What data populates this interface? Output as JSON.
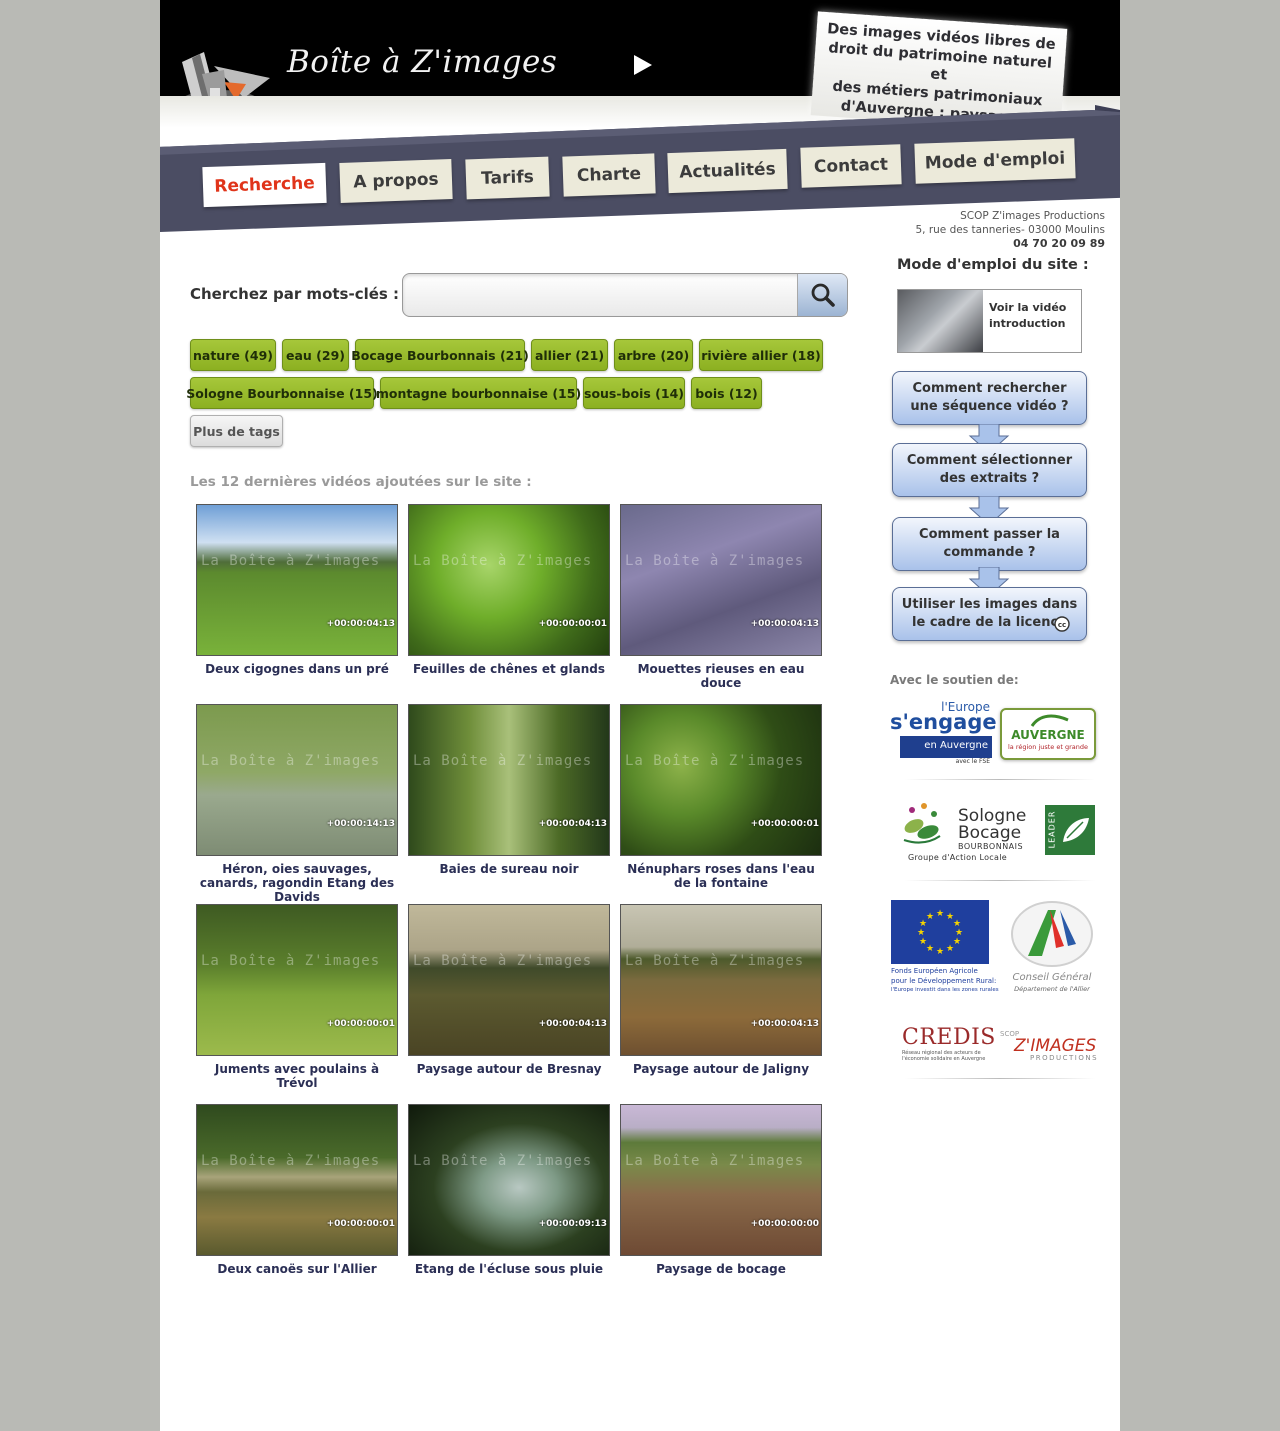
{
  "header": {
    "site_title": "Boîte à Z'images",
    "tagline": [
      "Des images vidéos libres de",
      "droit du patrimoine naturel et",
      "des métiers patrimoniaux",
      "d'Auvergne : paysages, flore.."
    ]
  },
  "nav": {
    "items": [
      {
        "label": "Recherche",
        "active": true
      },
      {
        "label": "A propos",
        "active": false
      },
      {
        "label": "Tarifs",
        "active": false
      },
      {
        "label": "Charte",
        "active": false
      },
      {
        "label": "Actualités",
        "active": false
      },
      {
        "label": "Contact",
        "active": false
      },
      {
        "label": "Mode d'emploi",
        "active": false
      }
    ]
  },
  "address": {
    "company": "SCOP Z'images Productions",
    "street": "5, rue des tanneries- 03000 Moulins",
    "phone": "04 70 20 09 89"
  },
  "search": {
    "label": "Cherchez par mots-clés :",
    "value": "",
    "placeholder": "",
    "button_icon": "search-icon"
  },
  "tags": [
    {
      "label": "nature (49)"
    },
    {
      "label": "eau (29)"
    },
    {
      "label": "Bocage Bourbonnais (21)"
    },
    {
      "label": "allier (21)"
    },
    {
      "label": "arbre (20)"
    },
    {
      "label": "rivière allier (18)"
    },
    {
      "label": "Sologne Bourbonnaise (15)"
    },
    {
      "label": "montagne bourbonnaise (15)"
    },
    {
      "label": "sous-bois (14)"
    },
    {
      "label": "bois (12)"
    }
  ],
  "more_tags_label": "Plus de tags",
  "latest": {
    "heading": "Les 12 dernières vidéos ajoutées sur le site :",
    "videos": [
      {
        "title": "Deux cigognes dans un pré",
        "duration": "+00:00:04:13",
        "watermark": "La Boîte à Z'images"
      },
      {
        "title": "Feuilles de chênes et glands",
        "duration": "+00:00:00:01",
        "watermark": "La Boîte à Z'images"
      },
      {
        "title": "Mouettes rieuses en eau douce",
        "duration": "+00:00:04:13",
        "watermark": "La Boîte à Z'images"
      },
      {
        "title": "Héron, oies sauvages, canards, ragondin Etang des Davids",
        "duration": "+00:00:14:13",
        "watermark": "La Boîte à Z'images"
      },
      {
        "title": "Baies de sureau noir",
        "duration": "+00:00:04:13",
        "watermark": "La Boîte à Z'images"
      },
      {
        "title": "Nénuphars roses dans l'eau de la fontaine",
        "duration": "+00:00:00:01",
        "watermark": "La Boîte à Z'images"
      },
      {
        "title": "Juments avec poulains à Trévol",
        "duration": "+00:00:00:01",
        "watermark": "La Boîte à Z'images"
      },
      {
        "title": "Paysage autour de Bresnay",
        "duration": "+00:00:04:13",
        "watermark": "La Boîte à Z'images"
      },
      {
        "title": "Paysage autour de Jaligny",
        "duration": "+00:00:04:13",
        "watermark": "La Boîte à Z'images"
      },
      {
        "title": "Deux canoës sur l'Allier",
        "duration": "+00:00:00:01",
        "watermark": "La Boîte à Z'images"
      },
      {
        "title": "Etang de l'écluse sous pluie",
        "duration": "+00:00:09:13",
        "watermark": "La Boîte à Z'images"
      },
      {
        "title": "Paysage de bocage",
        "duration": "+00:00:00:00",
        "watermark": "La Boîte à Z'images"
      }
    ]
  },
  "sidebar": {
    "title": "Mode d'emploi du site :",
    "intro_video": "Voir la vidéo introduction",
    "steps": [
      {
        "label": "Comment rechercher une séquence vidéo ?"
      },
      {
        "label": "Comment sélectionner des extraits ?"
      },
      {
        "label": "Comment passer la commande ?"
      },
      {
        "label": "Utiliser les images dans le cadre de la licence"
      }
    ],
    "support_label": "Avec le soutien de:",
    "logos": {
      "europe": {
        "line1": "l'Europe",
        "line2": "s'engage",
        "line3": "en Auvergne",
        "line4": "avec le FSE"
      },
      "auvergne": {
        "line1": "AUVERGNE",
        "line2": "la région juste et grande"
      },
      "sologne": {
        "line1": "Sologne",
        "line2": "Bocage",
        "line3": "BOURBONNAIS",
        "line4": "Groupe d'Action Locale"
      },
      "leader": "LEADER",
      "feader": {
        "line1": "Fonds Européen Agricole",
        "line2": "pour le Développement Rural:",
        "line3": "l'Europe investit dans les zones rurales"
      },
      "conseil": {
        "line1": "Conseil Général",
        "line2": "Département de l'Allier"
      },
      "credis": {
        "line1": "CREDIS",
        "line2": "Réseau régional des acteurs de",
        "line3": "l'économie solidaire en Auvergne"
      },
      "zimages": {
        "line1": "SCOP",
        "line2": "Z'IMAGES",
        "line3": "PRODUCTIONS"
      }
    }
  },
  "colors": {
    "page_background": "#b9bab5",
    "header_background": "#000000",
    "ribbon": "#4b4d63",
    "tab_background": "#eceada",
    "active_tab_text": "#e0341a",
    "tag_green": "#94b52a",
    "video_title": "#2b2f55",
    "step_blue": "#a9c2ea"
  }
}
